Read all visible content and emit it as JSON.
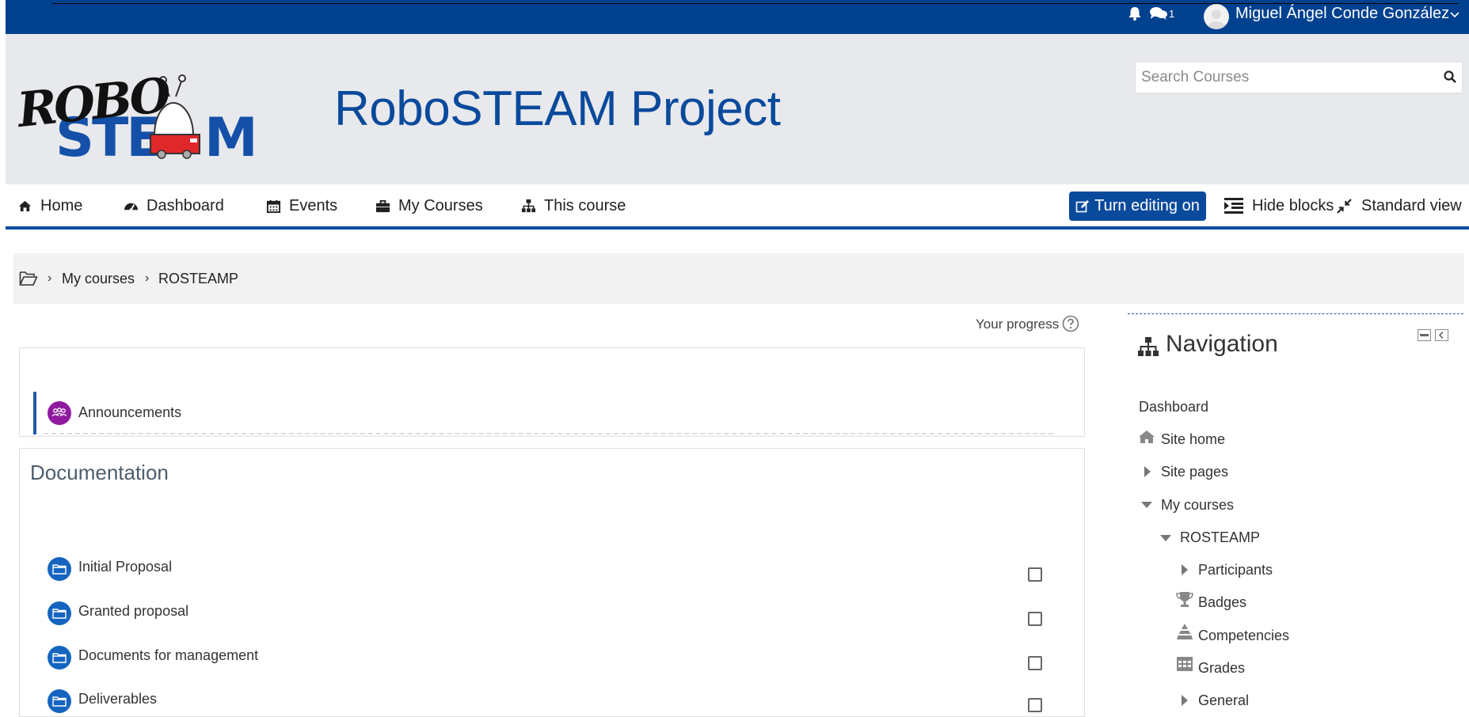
{
  "topbar": {
    "notification_count": "1",
    "user_name": "Miguel Ángel Conde González"
  },
  "header": {
    "site_title": "RoboSTEAM Project",
    "logo_text_top": "ROBO",
    "logo_text_bottom": "STEAM",
    "search_placeholder": "Search Courses"
  },
  "navbar": {
    "items": [
      {
        "label": "Home",
        "icon": "home-icon"
      },
      {
        "label": "Dashboard",
        "icon": "dashboard-icon"
      },
      {
        "label": "Events",
        "icon": "calendar-icon"
      },
      {
        "label": "My Courses",
        "icon": "briefcase-icon"
      },
      {
        "label": "This course",
        "icon": "sitemap-icon"
      }
    ],
    "edit_button": "Turn editing on",
    "hide_blocks": "Hide blocks",
    "standard_view": "Standard view"
  },
  "breadcrumb": {
    "items": [
      "My courses",
      "ROSTEAMP"
    ]
  },
  "course": {
    "progress_label": "Your progress",
    "section0": {
      "activities": [
        {
          "label": "Announcements",
          "icon": "forum-icon",
          "color": "#8f1a9e"
        }
      ]
    },
    "section1": {
      "title": "Documentation",
      "activities": [
        {
          "label": "Initial Proposal",
          "icon": "folder-icon",
          "color": "#1565c0"
        },
        {
          "label": "Granted proposal",
          "icon": "folder-icon",
          "color": "#1565c0"
        },
        {
          "label": "Documents for management",
          "icon": "folder-icon",
          "color": "#1565c0"
        },
        {
          "label": "Deliverables",
          "icon": "folder-icon",
          "color": "#1565c0"
        }
      ]
    }
  },
  "navigation_block": {
    "title": "Navigation",
    "items": [
      {
        "label": "Dashboard"
      },
      {
        "label": "Site home"
      },
      {
        "label": "Site pages"
      },
      {
        "label": "My courses"
      },
      {
        "label": "ROSTEAMP"
      },
      {
        "label": "Participants"
      },
      {
        "label": "Badges"
      },
      {
        "label": "Competencies"
      },
      {
        "label": "Grades"
      },
      {
        "label": "General"
      }
    ]
  },
  "colors": {
    "brand_blue": "#00418f",
    "accent_blue": "#0a4a9c",
    "header_bg": "#e8e9ec"
  }
}
